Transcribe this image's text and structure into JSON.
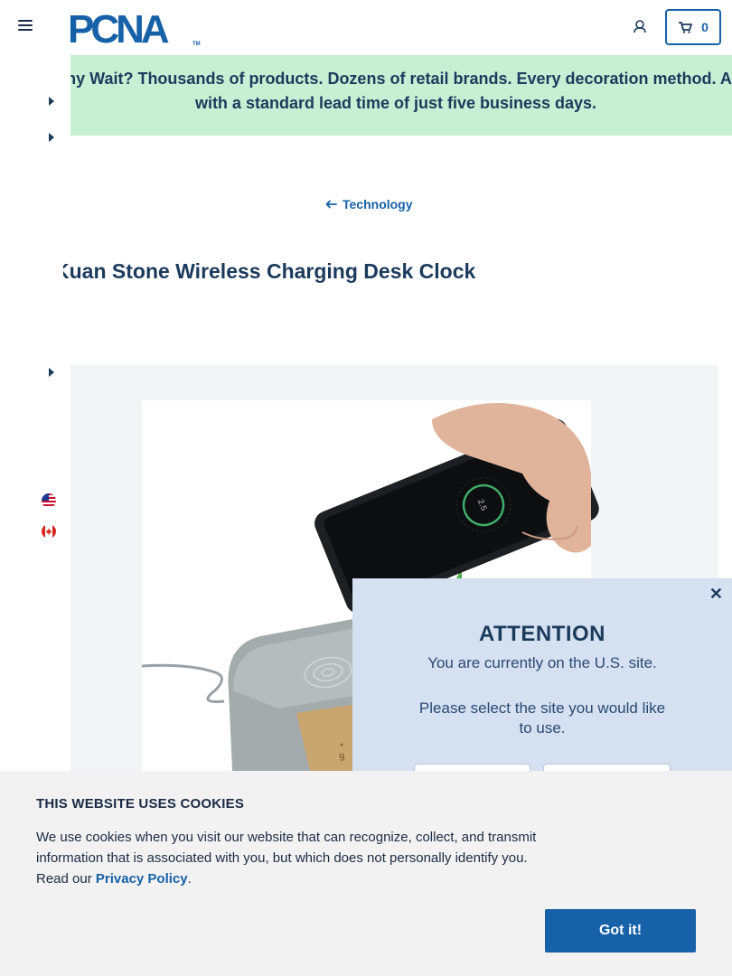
{
  "header": {
    "logo_text": "PCNA",
    "logo_tm": "TM",
    "cart_count": "0",
    "brand_color": "#1761a8"
  },
  "banner": {
    "text": "Why Wait? Thousands of products. Dozens of retail brands. Every decoration method. All with a standard lead time of just five business days."
  },
  "breadcrumb": {
    "label": "Technology"
  },
  "product": {
    "title": "Kuan Stone Wireless Charging Desk Clock",
    "phone_display": "2.5"
  },
  "modal": {
    "title": "ATTENTION",
    "line1": "You are currently on the U.S. site.",
    "line2": "Please select the site you would like to use.",
    "close_symbol": "✕"
  },
  "cookie": {
    "title": "THIS WEBSITE USES COOKIES",
    "text_before_link": "We use cookies when you visit our website that can recognize, collect, and transmit information that is associated with you, but which does not personally identify you. Read our ",
    "link": "Privacy Policy",
    "text_after_link": ".",
    "accept_label": "Got it!"
  },
  "icons": [
    "menu-icon",
    "account-icon",
    "cart-icon",
    "arrow-left-icon",
    "caret-right-icon",
    "us-flag-icon",
    "canada-flag-icon",
    "close-icon"
  ]
}
